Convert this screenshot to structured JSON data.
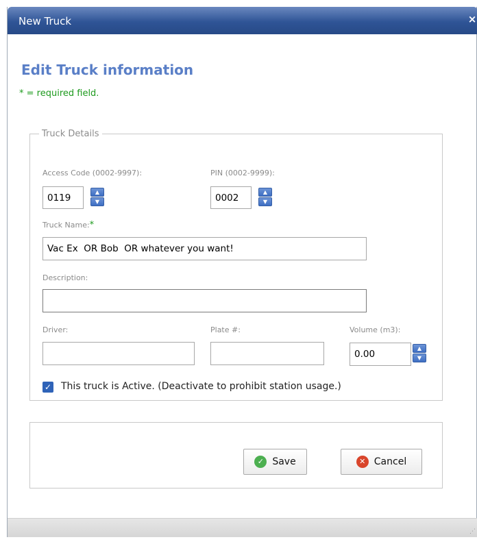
{
  "window": {
    "title": "New Truck",
    "close_glyph": "×",
    "close_icon": "close-icon"
  },
  "form": {
    "heading": "Edit Truck information",
    "required_note": "* = required field.",
    "fieldset_legend": "Truck Details",
    "access_code": {
      "label": "Access Code (0002-9997):",
      "value": "0119"
    },
    "pin": {
      "label": "PIN (0002-9999):",
      "value": "0002"
    },
    "truck_name": {
      "label": "Truck Name:",
      "required_mark": "*",
      "value": "Vac Ex  OR Bob  OR whatever you want!"
    },
    "description": {
      "label": "Description:",
      "value": ""
    },
    "driver": {
      "label": "Driver:",
      "value": ""
    },
    "plate": {
      "label": "Plate #:",
      "value": ""
    },
    "volume": {
      "label": "Volume (m3):",
      "value": "0.00"
    },
    "active": {
      "label": "This truck is Active. (Deactivate to prohibit station usage.)",
      "checked": true
    }
  },
  "buttons": {
    "save": {
      "label": "Save",
      "icon": "check-circle-icon",
      "color": "#4caf50"
    },
    "cancel": {
      "label": "Cancel",
      "icon": "x-circle-icon",
      "color": "#d9452b"
    }
  },
  "colors": {
    "titlebar": "#2f5496",
    "heading": "#5a7fc7",
    "required": "#1d9a1d",
    "accent": "#2f63b8"
  }
}
